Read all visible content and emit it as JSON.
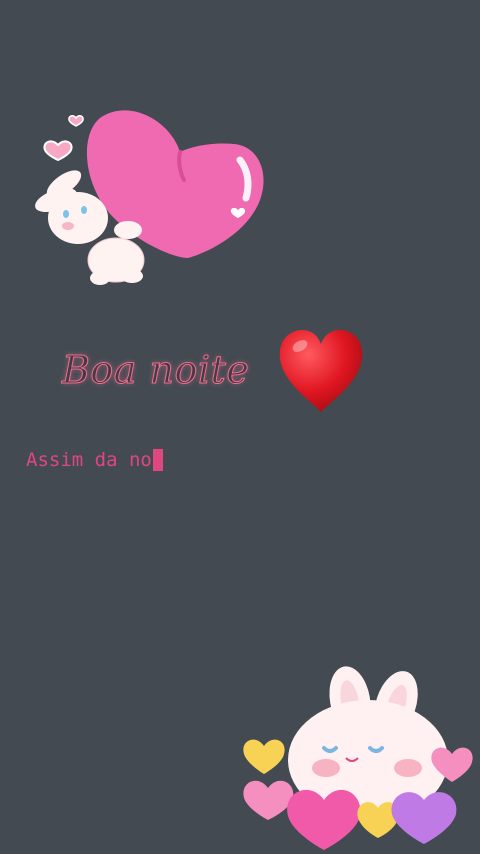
{
  "greeting": {
    "text": "Boa noite",
    "emoji": "red-heart-icon"
  },
  "typing": {
    "text": "Assim da no"
  },
  "stickers": {
    "top": "bunny-hugging-heart-icon",
    "bottom": "bunny-with-hearts-icon"
  },
  "colors": {
    "background": "#434a52",
    "accent_pink": "#e0467f",
    "neon_outline": "#f06e8f",
    "heart_red": "#e01622"
  }
}
